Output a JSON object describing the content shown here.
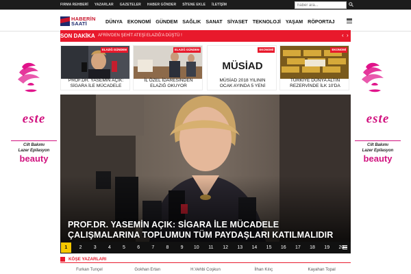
{
  "topbar": {
    "links": [
      "FIRMA REHBERİ",
      "YAZARLAR",
      "GAZETELER",
      "HABER GÖNDER",
      "SİTENE EKLE",
      "İLETİŞİM"
    ],
    "search_placeholder": "haber ara...",
    "search_icon": "search-icon"
  },
  "logo": {
    "line1": "HABERİN",
    "line2": "SAATİ"
  },
  "nav": {
    "items": [
      "DÜNYA",
      "EKONOMİ",
      "GÜNDEM",
      "SAĞLIK",
      "SANAT",
      "SİYASET",
      "TEKNOLOJİ",
      "YAŞAM",
      "RÖPORTAJ"
    ]
  },
  "breaking": {
    "label": "SON DAKİKA",
    "text": "AFRİN'DEN ŞEHİT ATEŞİ ELAZIĞ'A DÜŞTÜ !"
  },
  "cards": [
    {
      "tag": "ELAZIĞ GÜNDEM",
      "title1": "PROF.DR. YASEMİN AÇIK:",
      "title2": "SİGARA İLE MÜCADELE"
    },
    {
      "tag": "ELAZIĞ GÜNDEM",
      "title1": "İL ÖZEL İDARESİNDEN",
      "title2": "ELAZIĞ OKUYOR"
    },
    {
      "tag": "EKONOMİ",
      "image_text": "MÜSİAD",
      "title1": "MÜSİAD 2018 YILININ",
      "title2": "OCAK AYINDA 5 YENİ"
    },
    {
      "tag": "EKONOMİ",
      "title1": "TÜRKİYE DÜNYA ALTIN",
      "title2": "REZERVİNDE İLK 10'DA"
    }
  ],
  "hero": {
    "title1": "PROF.DR. YASEMİN AÇIK: SİGARA İLE MÜCADELE",
    "title2": "ÇALIŞMALARINA TOPLUMUN TÜM PAYDAŞLARI KATILMALIDIR",
    "pages": [
      "1",
      "2",
      "3",
      "4",
      "5",
      "6",
      "7",
      "8",
      "9",
      "10",
      "11",
      "12",
      "13",
      "14",
      "15",
      "16",
      "17",
      "18",
      "19",
      "20"
    ],
    "active_page": "1"
  },
  "ad": {
    "brand": "este",
    "line1": "Cilt Bakımı",
    "line2": "Lazer Epilasyon",
    "word": "beauty"
  },
  "columnists": {
    "label": "KÖŞE YAZARLARI",
    "authors": [
      "Furkan Tunçel",
      "Gokhan Ertan",
      "H.Vehbi Coşkun",
      "İlhan Kılıç",
      "Kayahan Topal"
    ]
  },
  "colors": {
    "accent": "#e8192c",
    "topbar": "#1c1c1c",
    "pager_active": "#f6c800",
    "ad_pink": "#d1127f"
  }
}
